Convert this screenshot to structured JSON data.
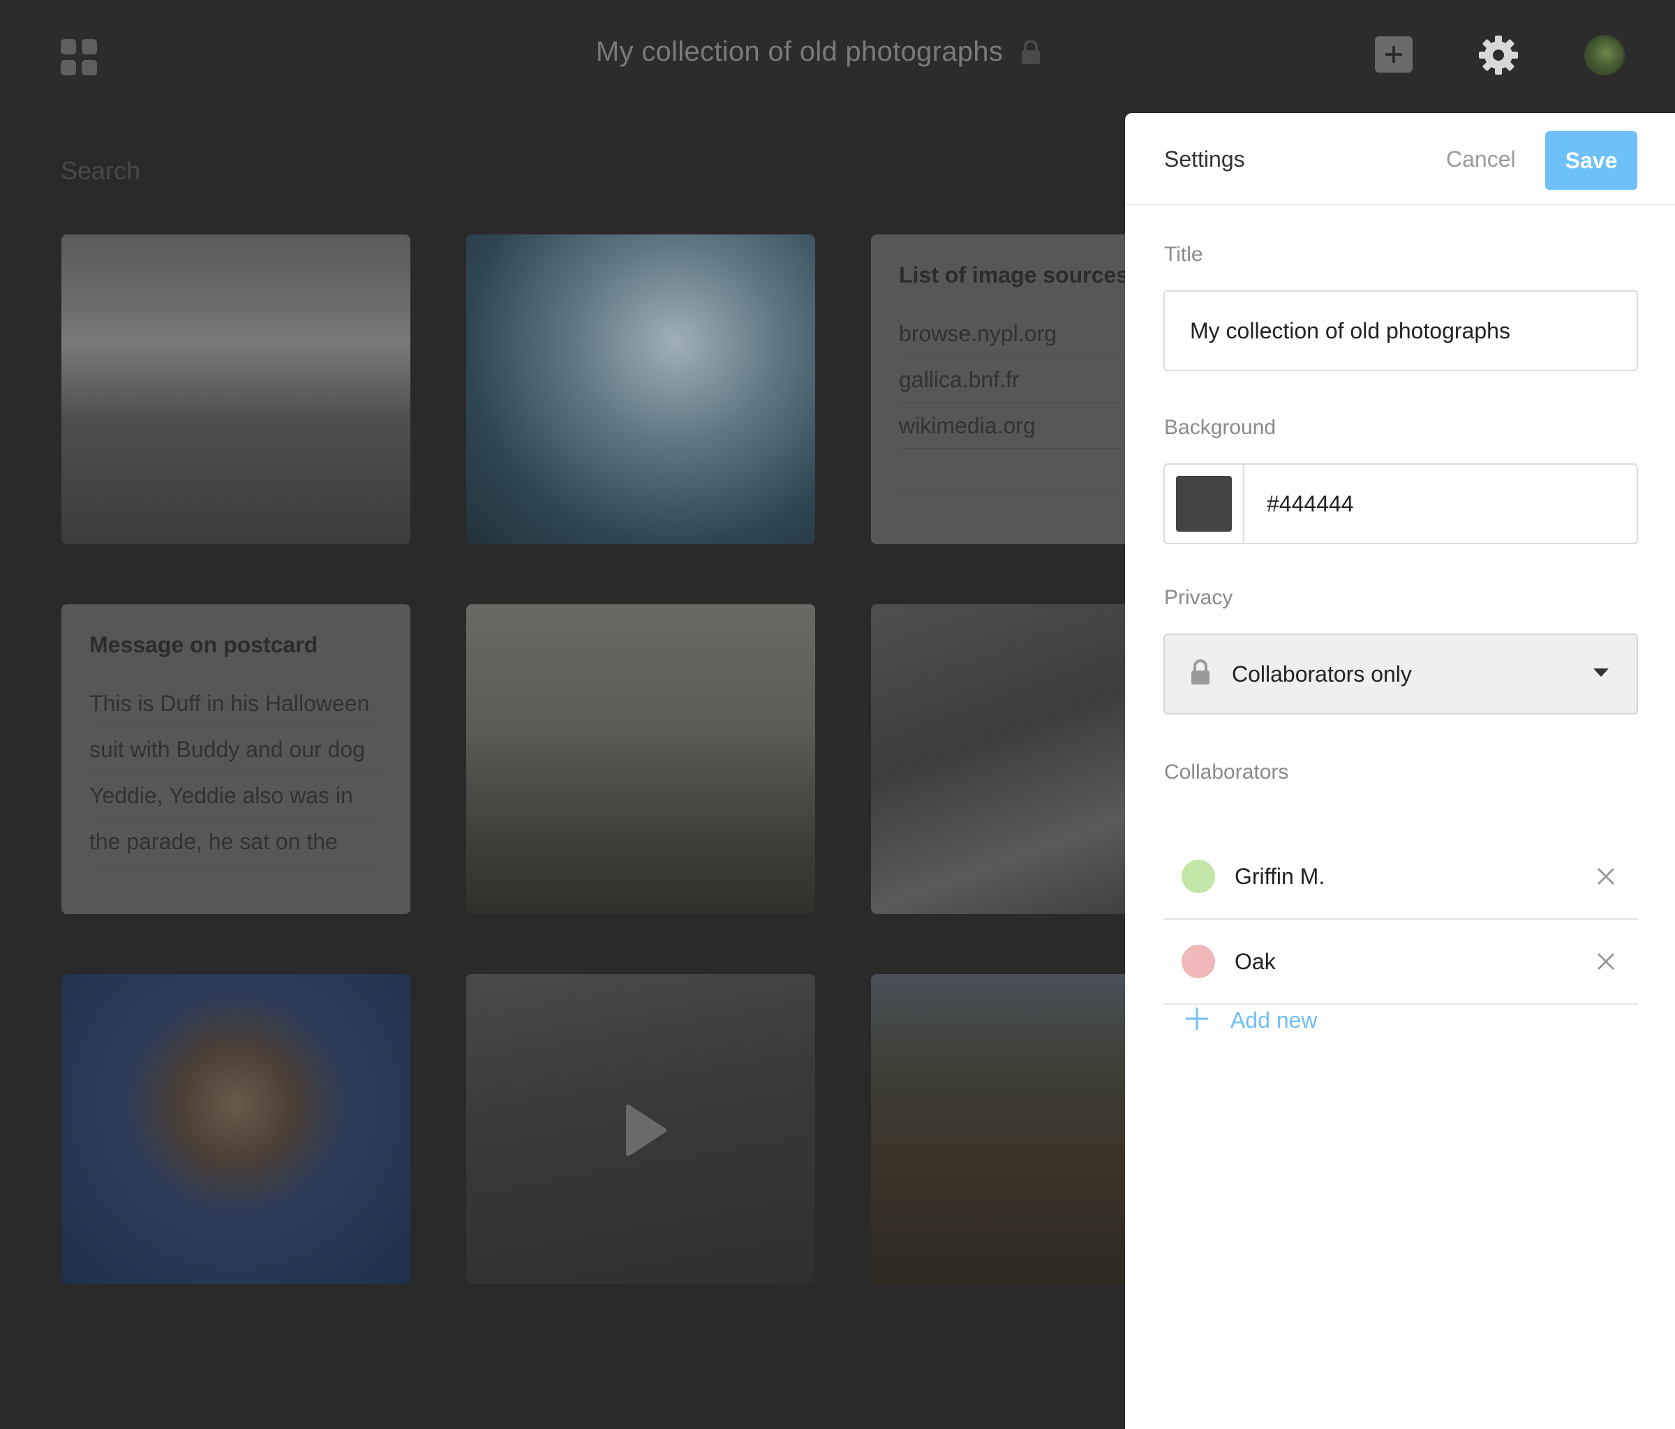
{
  "topbar": {
    "title": "My collection of old photographs",
    "icons": [
      "apps-grid-icon",
      "lock-icon",
      "add-icon",
      "gear-icon",
      "avatar"
    ]
  },
  "search": {
    "placeholder": "Search"
  },
  "cards": {
    "sources": {
      "title": "List of image sources",
      "lines": [
        "browse.nypl.org",
        "gallica.bnf.fr",
        "wikimedia.org",
        ""
      ]
    },
    "postcard": {
      "title": "Message on postcard",
      "lines": [
        "This is Duff in his Halloween",
        "suit with Buddy and our dog",
        "Yeddie, Yeddie also was in",
        "the parade, he sat on the"
      ]
    }
  },
  "settings": {
    "title": "Settings",
    "cancel_label": "Cancel",
    "save_label": "Save",
    "title_label": "Title",
    "title_value": "My collection of old photographs",
    "background_label": "Background",
    "background_value": "#444444",
    "privacy_label": "Privacy",
    "privacy_value": "Collaborators only",
    "collaborators_label": "Collaborators",
    "collaborators": [
      {
        "name": "Griffin M.",
        "color": "#c3e6a8"
      },
      {
        "name": "Oak",
        "color": "#f0b8b8"
      }
    ],
    "add_new_label": "Add new"
  },
  "colors": {
    "accent": "#6ec0f8",
    "page_background": "#2a2a2a",
    "panel_background": "#ffffff"
  }
}
